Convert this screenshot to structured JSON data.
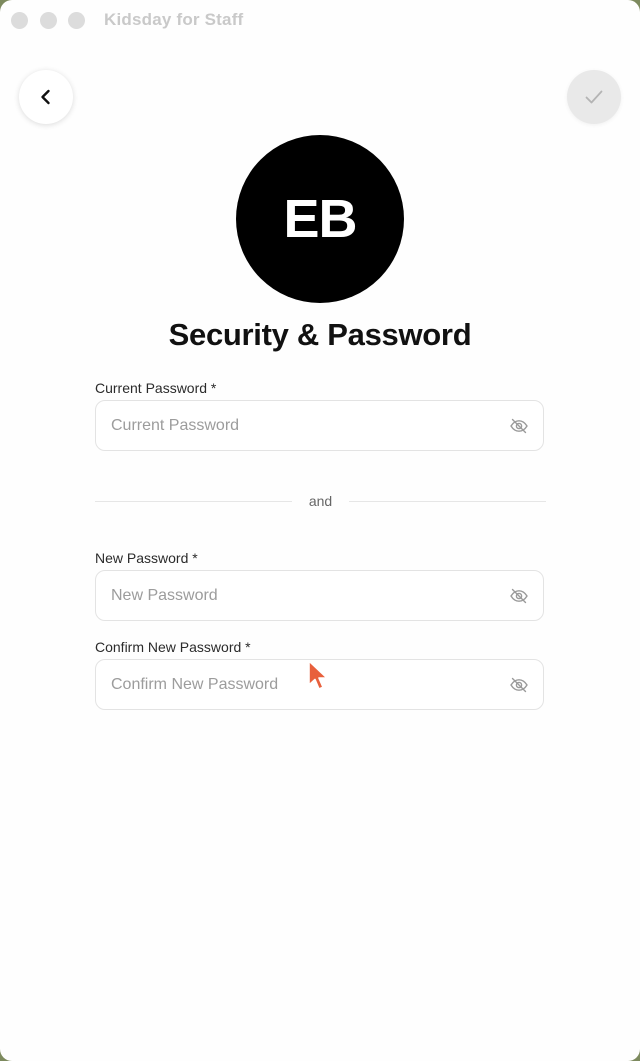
{
  "window": {
    "title": "Kidsday for Staff"
  },
  "nav": {
    "back_icon": "chevron-left-icon",
    "save_icon": "checkmark-icon"
  },
  "profile": {
    "initials": "EB"
  },
  "page": {
    "title": "Security & Password"
  },
  "form": {
    "current_password": {
      "label": "Current Password *",
      "placeholder": "Current Password",
      "value": "",
      "toggle_icon": "eye-off-icon"
    },
    "separator": "and",
    "new_password": {
      "label": "New Password *",
      "placeholder": "New Password",
      "value": "",
      "toggle_icon": "eye-off-icon"
    },
    "confirm_password": {
      "label": "Confirm New Password *",
      "placeholder": "Confirm New Password",
      "value": "",
      "toggle_icon": "eye-off-icon"
    }
  },
  "colors": {
    "avatar_bg": "#000000",
    "save_button_bg": "#e9e9e9",
    "cursor": "#e8603c"
  }
}
